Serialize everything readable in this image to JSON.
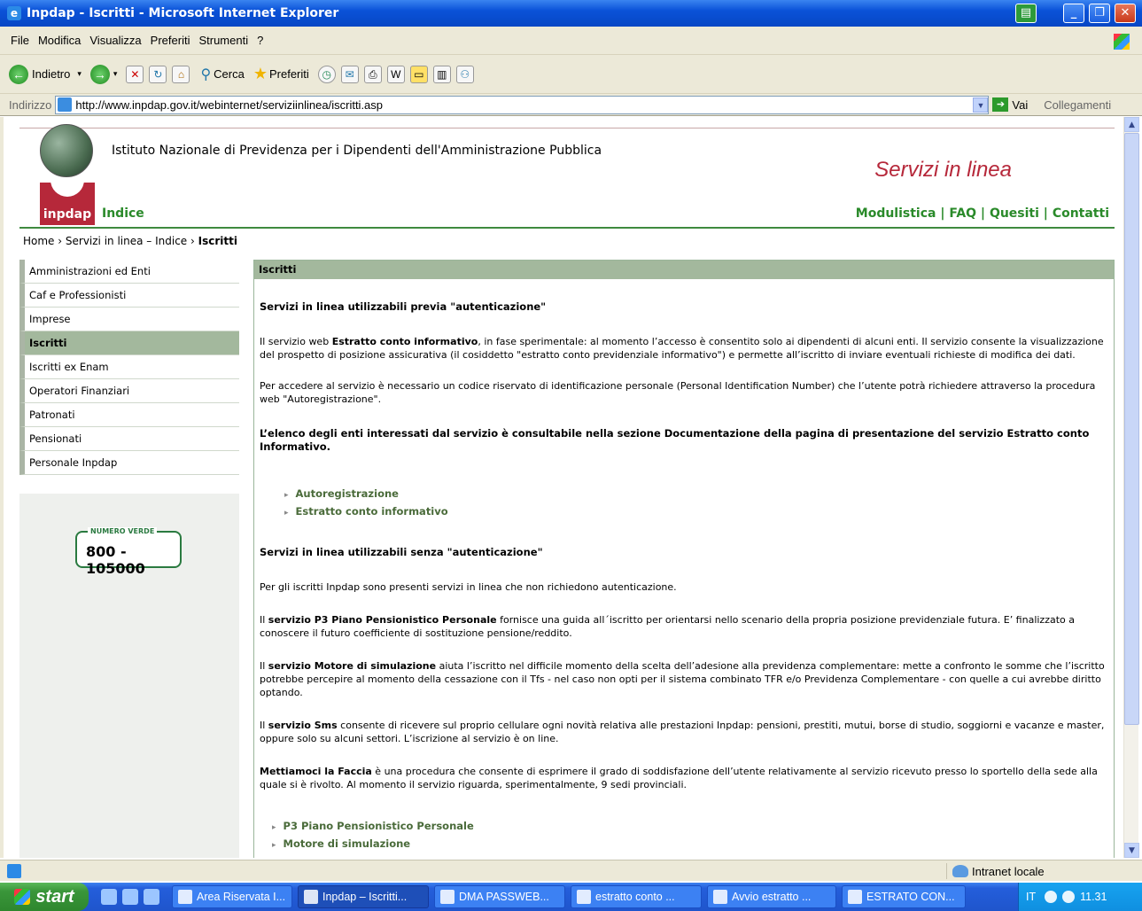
{
  "window": {
    "title": "Inpdap - Iscritti - Microsoft Internet Explorer"
  },
  "menu": [
    "File",
    "Modifica",
    "Visualizza",
    "Preferiti",
    "Strumenti",
    "?"
  ],
  "toolbar": {
    "back": "Indietro",
    "search": "Cerca",
    "favorites": "Preferiti"
  },
  "address": {
    "label": "Indirizzo",
    "url": "http://www.inpdap.gov.it/webinternet/serviziinlinea/iscritti.asp",
    "go": "Vai",
    "links": "Collegamenti"
  },
  "header": {
    "institute": "Istituto Nazionale di Previdenza per i Dipendenti dell'Amministrazione Pubblica",
    "services": "Servizi in linea",
    "logo": "inpdap",
    "index": "Indice",
    "links": [
      "Modulistica",
      "FAQ",
      "Quesiti",
      "Contatti"
    ]
  },
  "breadcrumb": {
    "home": "Home",
    "mid": "Servizi in linea – Indice",
    "current": "Iscritti"
  },
  "sidebar": {
    "items": [
      {
        "label": "Amministrazioni ed Enti"
      },
      {
        "label": "Caf e Professionisti"
      },
      {
        "label": "Imprese"
      },
      {
        "label": "Iscritti"
      },
      {
        "label": "Iscritti ex Enam"
      },
      {
        "label": "Operatori Finanziari"
      },
      {
        "label": "Patronati"
      },
      {
        "label": "Pensionati"
      },
      {
        "label": "Personale Inpdap"
      }
    ],
    "numero_verde_label": "NUMERO VERDE",
    "numero_verde": "800 - 105000"
  },
  "main": {
    "title": "Iscritti",
    "h1": "Servizi in linea utilizzabili previa \"autenticazione\"",
    "p1_a": "Il servizio web ",
    "p1_b": "Estratto conto informativo",
    "p1_c": ", in fase sperimentale: al momento l’accesso è consentito solo ai dipendenti di alcuni enti. Il servizio consente la visualizzazione del prospetto di posizione assicurativa (il cosiddetto \"estratto conto previdenziale informativo\") e permette all’iscritto di inviare eventuali richieste di modifica dei dati.",
    "p2": "Per accedere al servizio è necessario un codice riservato di identificazione personale (Personal Identification Number) che l’utente potrà richiedere attraverso la procedura web \"Autoregistrazione\".",
    "p3": "L’elenco degli enti interessati dal servizio è consultabile nella sezione Documentazione della pagina di presentazione del servizio Estratto conto Informativo.",
    "links1": [
      "Autoregistrazione",
      "Estratto conto informativo"
    ],
    "h2": "Servizi in linea utilizzabili senza \"autenticazione\"",
    "p4": "Per gli iscritti Inpdap sono presenti servizi in linea che non richiedono autenticazione.",
    "p5_a": "Il ",
    "p5_b": "servizio  P3 Piano Pensionistico Personale",
    "p5_c": " fornisce una guida all´iscritto per orientarsi nello scenario della propria posizione previdenziale futura. E’ finalizzato a conoscere il futuro coefficiente di sostituzione pensione/reddito.",
    "p6_a": "Il ",
    "p6_b": "servizio Motore di simulazione",
    "p6_c": " aiuta l’iscritto nel difficile momento della scelta dell’adesione alla previdenza complementare: mette a confronto   le somme che l’iscritto potrebbe percepire al momento della cessazione  con il Tfs  -  nel caso non opti per il sistema combinato TFR e/o Previdenza Complementare  - con quelle a cui avrebbe diritto optando.",
    "p7_a": "Il ",
    "p7_b": "servizio Sms",
    "p7_c": " consente di ricevere sul proprio cellulare ogni novità relativa alle prestazioni Inpdap: pensioni, prestiti, mutui, borse di studio, soggiorni e vacanze e master, oppure solo su alcuni settori. L’iscrizione al servizio è on line.",
    "p8_a": "Mettiamoci la Faccia",
    "p8_b": " è una procedura che consente di esprimere il grado di soddisfazione dell’utente relativamente al servizio ricevuto presso lo sportello della sede alla quale si è rivolto. Al momento il servizio riguarda, sperimentalmente, 9 sedi provinciali.",
    "links2": [
      "P3 Piano Pensionistico Personale",
      "Motore di simulazione"
    ]
  },
  "status": {
    "zone": "Intranet locale"
  },
  "taskbar": {
    "start": "start",
    "tasks": [
      "Area Riservata I...",
      "Inpdap – Iscritti...",
      "DMA PASSWEB...",
      "estratto conto ...",
      "Avvio estratto ...",
      "ESTRATO CON..."
    ],
    "lang": "IT",
    "clock": "11.31"
  }
}
